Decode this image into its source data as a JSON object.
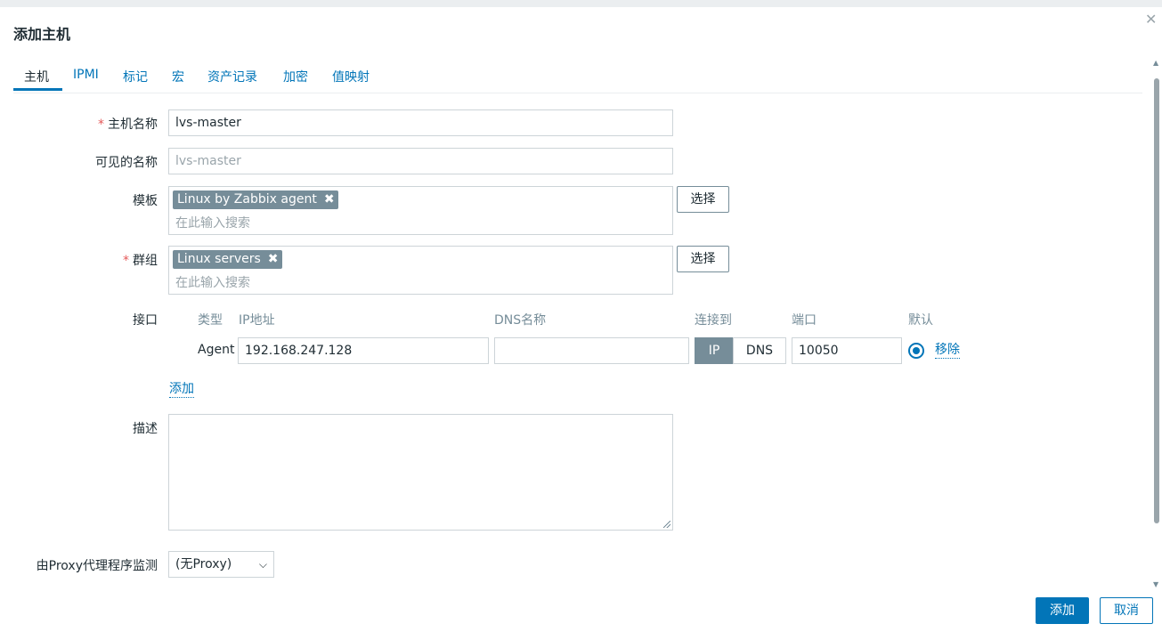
{
  "dialog": {
    "title": "添加主机",
    "close_icon": "close-icon"
  },
  "tabs": [
    {
      "label": "主机",
      "active": true
    },
    {
      "label": "IPMI"
    },
    {
      "label": "标记"
    },
    {
      "label": "宏"
    },
    {
      "label": "资产记录"
    },
    {
      "label": "加密"
    },
    {
      "label": "值映射"
    }
  ],
  "form": {
    "host_name": {
      "required_mark": "*",
      "label": "主机名称",
      "value": "lvs-master"
    },
    "visible_name": {
      "label": "可见的名称",
      "placeholder": "lvs-master"
    },
    "templates": {
      "label": "模板",
      "chips": [
        "Linux by Zabbix agent"
      ],
      "search_placeholder": "在此输入搜索",
      "select_label": "选择"
    },
    "groups": {
      "required_mark": "*",
      "label": "群组",
      "chips": [
        "Linux servers"
      ],
      "search_placeholder": "在此输入搜索",
      "select_label": "选择"
    },
    "interfaces": {
      "label": "接口",
      "headers": {
        "type": "类型",
        "ip": "IP地址",
        "dns": "DNS名称",
        "connect_to": "连接到",
        "port": "端口",
        "default": "默认"
      },
      "rows": [
        {
          "type": "Agent",
          "ip": "192.168.247.128",
          "dns": "",
          "connect_ip": "IP",
          "connect_dns": "DNS",
          "port": "10050",
          "remove": "移除"
        }
      ],
      "add_link": "添加"
    },
    "description": {
      "label": "描述",
      "value": ""
    },
    "proxy": {
      "label": "由Proxy代理程序监测",
      "selected": "(无Proxy)"
    }
  },
  "footer": {
    "add": "添加",
    "cancel": "取消"
  },
  "colors": {
    "accent": "#0275b8",
    "chip": "#768d99",
    "required": "#e45959"
  }
}
